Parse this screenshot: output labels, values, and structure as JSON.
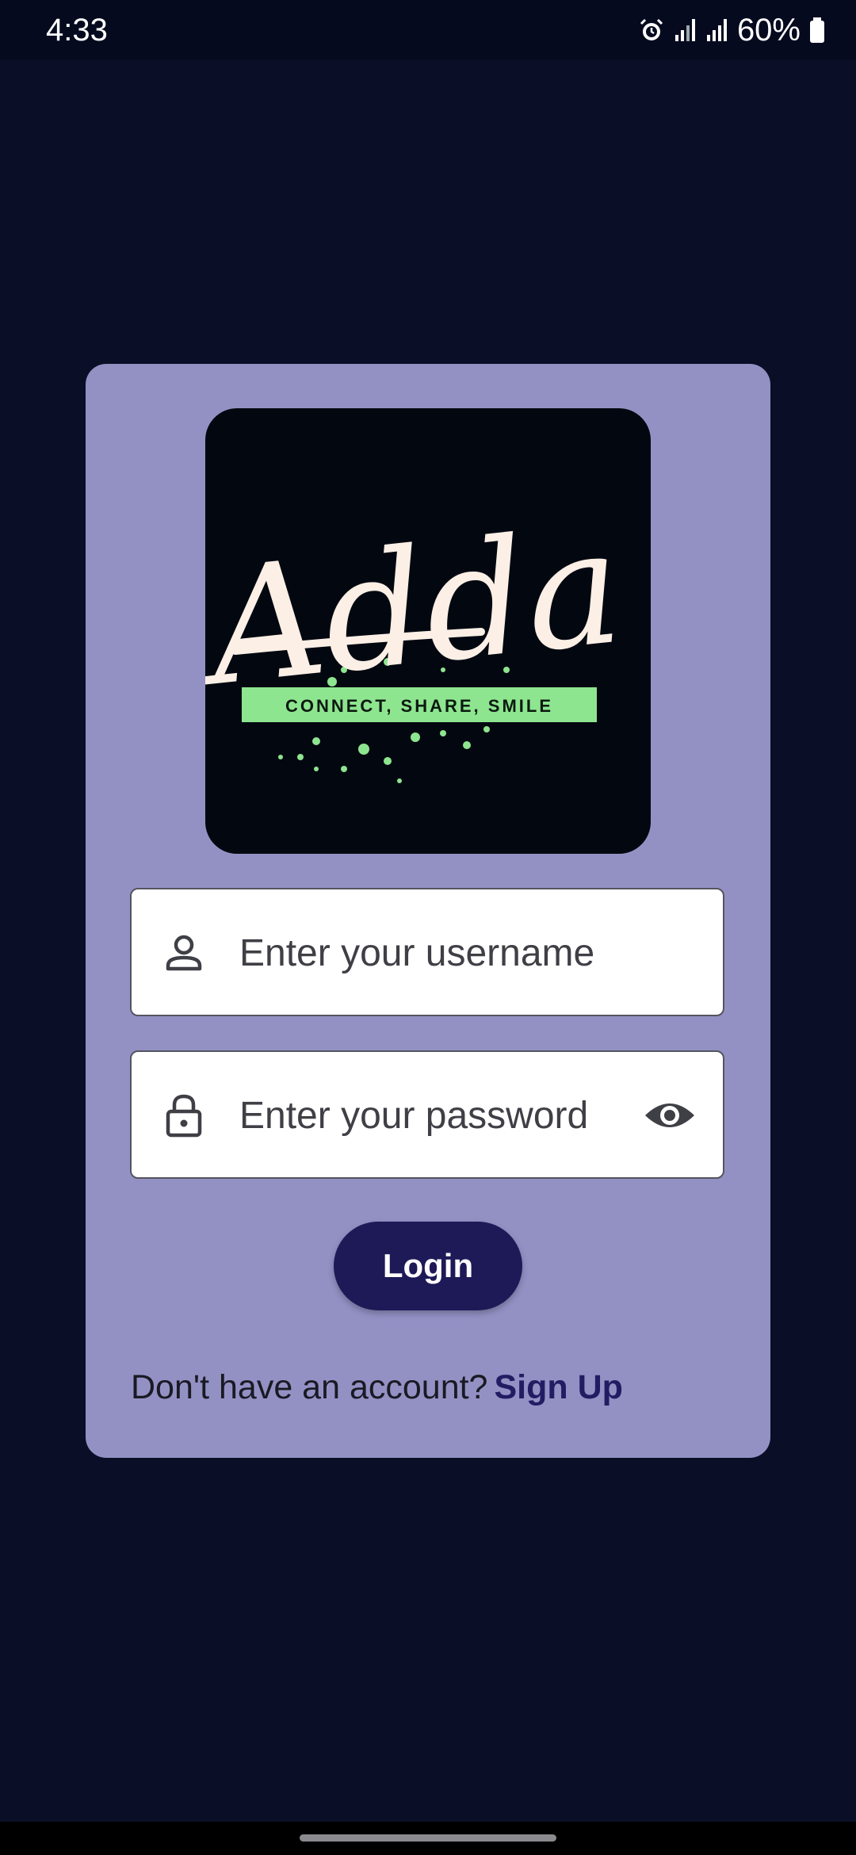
{
  "status_bar": {
    "time": "4:33",
    "battery": "60%",
    "icons": [
      "alarm-icon",
      "signal-icon",
      "signal-icon",
      "battery-icon"
    ]
  },
  "logo": {
    "brand_text": "Adda",
    "tagline": "CONNECT, SHARE, SMILE",
    "accent_color": "#8ee58f"
  },
  "form": {
    "username_placeholder": "Enter your username",
    "password_placeholder": "Enter your password",
    "login_label": "Login",
    "signup_prompt": "Don't have an account?",
    "signup_link": "Sign Up"
  },
  "colors": {
    "background": "#0a0f27",
    "card": "#9391c4",
    "button": "#1e1a58",
    "link": "#221c63"
  }
}
